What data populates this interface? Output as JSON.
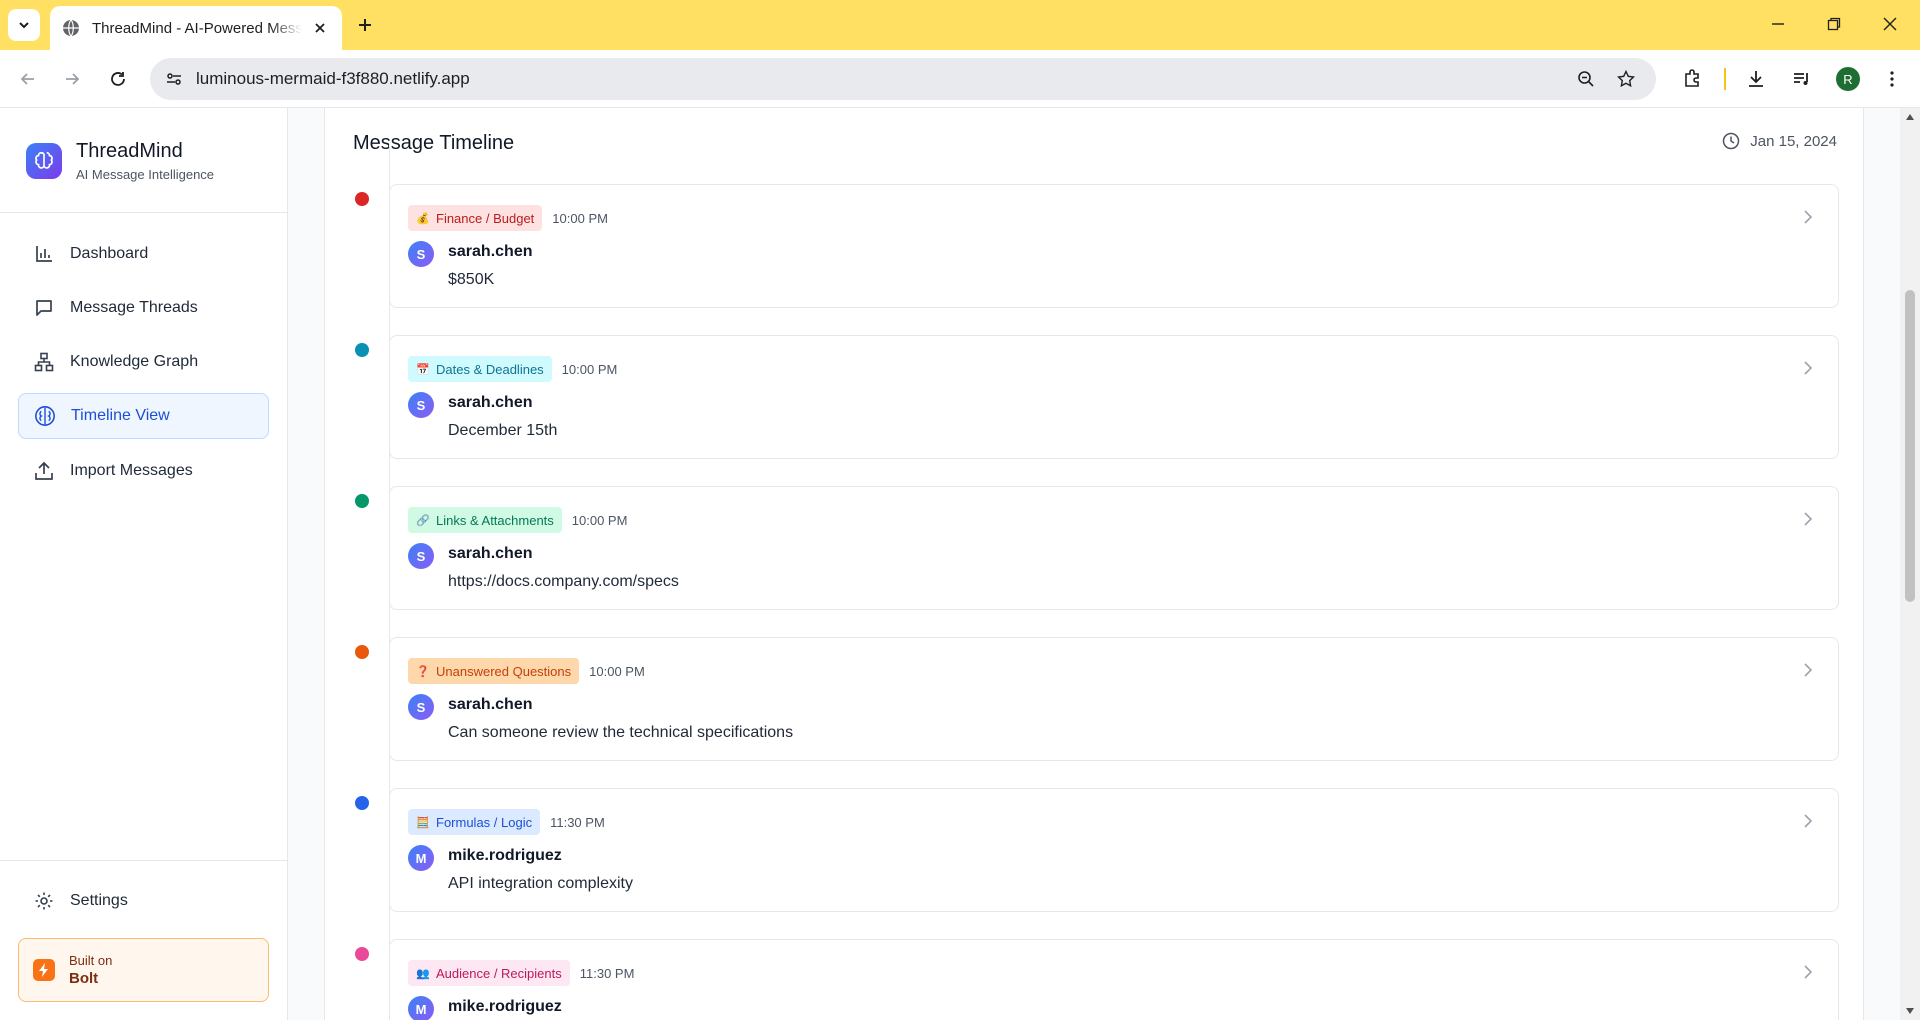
{
  "browser": {
    "tab_title": "ThreadMind - AI-Powered Message Intelligence",
    "url": "luminous-mermaid-f3f880.netlify.app",
    "profile_initial": "R",
    "accent": "#ffe062"
  },
  "sidebar": {
    "brand_name": "ThreadMind",
    "brand_sub": "AI Message Intelligence",
    "items": [
      {
        "label": "Dashboard",
        "icon": "bar-chart-icon"
      },
      {
        "label": "Message Threads",
        "icon": "message-square-icon"
      },
      {
        "label": "Knowledge Graph",
        "icon": "network-icon"
      },
      {
        "label": "Timeline View",
        "icon": "brain-icon",
        "active": true
      },
      {
        "label": "Import Messages",
        "icon": "upload-icon"
      }
    ],
    "settings_label": "Settings",
    "bolt": {
      "top": "Built on",
      "name": "Bolt"
    }
  },
  "timeline": {
    "title": "Message Timeline",
    "date": "Jan 15, 2024",
    "entries": [
      {
        "category": "Finance / Budget",
        "emoji": "💰",
        "time": "10:00 PM",
        "initial": "S",
        "author": "sarah.chen",
        "text": "$850K",
        "dot": "#dc2626",
        "badge_bg": "#fee2e2",
        "badge_fg": "#b91c1c"
      },
      {
        "category": "Dates & Deadlines",
        "emoji": "📅",
        "time": "10:00 PM",
        "initial": "S",
        "author": "sarah.chen",
        "text": "December 15th",
        "dot": "#0891b2",
        "badge_bg": "#cffafe",
        "badge_fg": "#0e7490"
      },
      {
        "category": "Links & Attachments",
        "emoji": "🔗",
        "time": "10:00 PM",
        "initial": "S",
        "author": "sarah.chen",
        "text": "https://docs.company.com/specs",
        "dot": "#059669",
        "badge_bg": "#d1fae5",
        "badge_fg": "#047857"
      },
      {
        "category": "Unanswered Questions",
        "emoji": "❓",
        "time": "10:00 PM",
        "initial": "S",
        "author": "sarah.chen",
        "text": "Can someone review the technical specifications",
        "dot": "#ea580c",
        "badge_bg": "#fed7aa",
        "badge_fg": "#c2410c"
      },
      {
        "category": "Formulas / Logic",
        "emoji": "🧮",
        "time": "11:30 PM",
        "initial": "M",
        "author": "mike.rodriguez",
        "text": "API integration complexity",
        "dot": "#2563eb",
        "badge_bg": "#dbeafe",
        "badge_fg": "#1d4ed8"
      },
      {
        "category": "Audience / Recipients",
        "emoji": "👥",
        "time": "11:30 PM",
        "initial": "M",
        "author": "mike.rodriguez",
        "text": "",
        "dot": "#ec4899",
        "badge_bg": "#fce7f3",
        "badge_fg": "#be185d"
      }
    ]
  }
}
